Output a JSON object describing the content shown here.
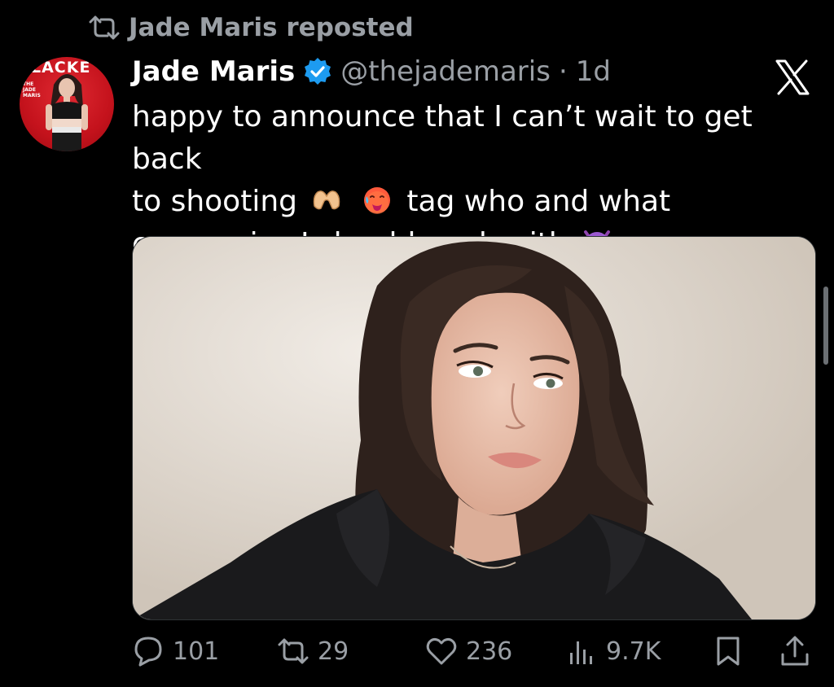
{
  "repost": {
    "icon": "repost-icon",
    "label": "Jade Maris reposted"
  },
  "author": {
    "display_name": "Jade Maris",
    "verified": true,
    "handle": "@thejademaris",
    "separator": "·",
    "time": "1d",
    "avatar_brand_text": "LACKE",
    "avatar_small_text": "THE JADE MARIS"
  },
  "tweet": {
    "line1": "happy to announce that I can’t wait to get back",
    "line2_prefix": "to shooting",
    "line2_suffix": "tag who and what",
    "line3": "companies I should work with",
    "emojis": [
      "heart-hands-emoji",
      "hot-face-emoji",
      "smiling-devil-emoji"
    ]
  },
  "actions": {
    "replies": "101",
    "reposts": "29",
    "likes": "236",
    "views": "9.7K"
  },
  "colors": {
    "background": "#000000",
    "text": "#ffffff",
    "secondary": "#9a9fa5",
    "verified": "#1d9bf0"
  }
}
